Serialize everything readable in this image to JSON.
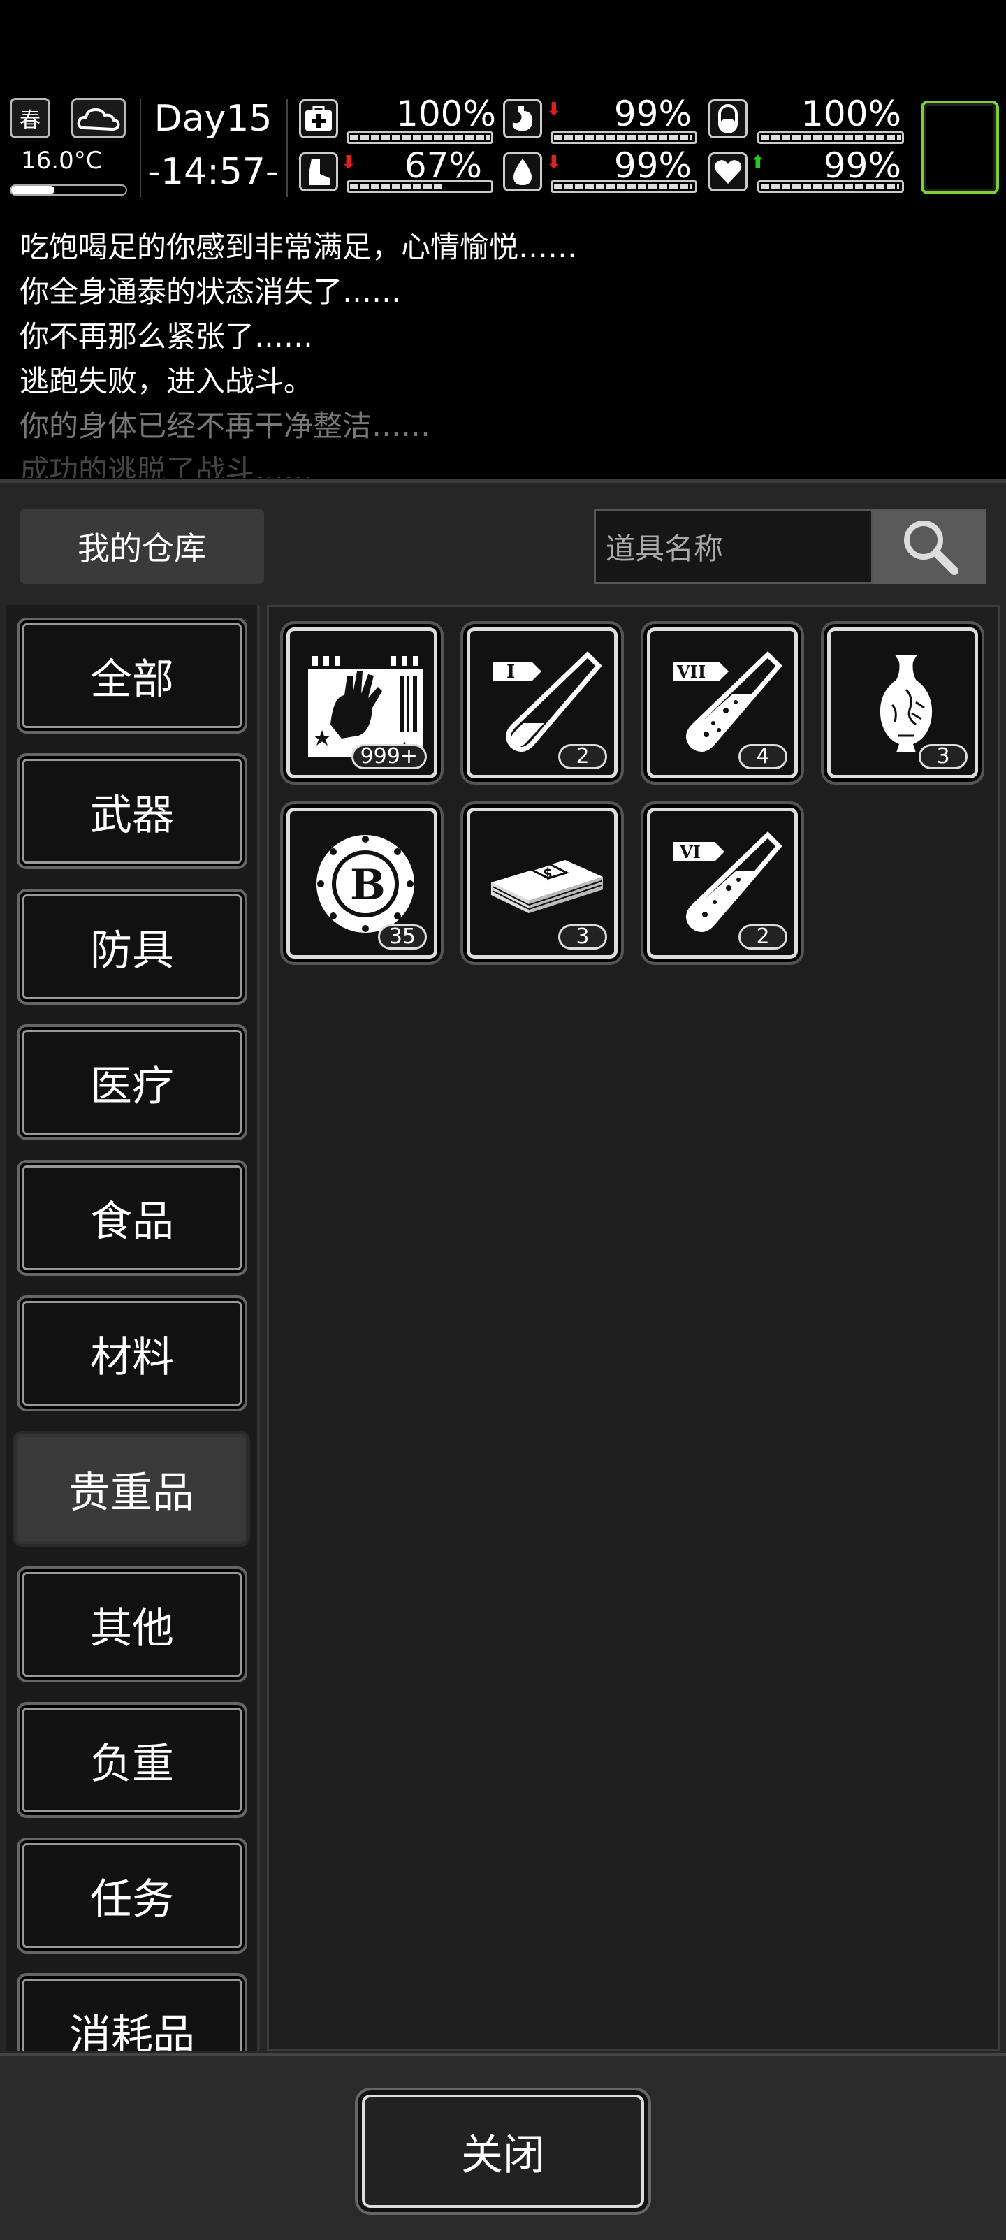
{
  "hud": {
    "season": "春",
    "temperature": "16.0°C",
    "day": "Day15",
    "time": "-14:57-",
    "stats": [
      {
        "name": "health",
        "icon": "medkit-icon",
        "value": "100%",
        "level": 1.0,
        "trend": ""
      },
      {
        "name": "hunger",
        "icon": "stomach-icon",
        "value": "99%",
        "level": 0.99,
        "trend": "down"
      },
      {
        "name": "sleep",
        "icon": "pill-icon",
        "value": "100%",
        "level": 1.0,
        "trend": ""
      },
      {
        "name": "stamina",
        "icon": "boot-icon",
        "value": "67%",
        "level": 0.67,
        "trend": "down"
      },
      {
        "name": "thirst",
        "icon": "water-drop-icon",
        "value": "99%",
        "level": 0.99,
        "trend": "down"
      },
      {
        "name": "mood",
        "icon": "heart-icon",
        "value": "99%",
        "level": 0.99,
        "trend": "up"
      }
    ],
    "colors": {
      "trend_down": "#e02020",
      "trend_up": "#28c828",
      "portrait_border": "#7ad236"
    }
  },
  "log": {
    "lines": [
      "吃饱喝足的你感到非常满足，心情愉悦……",
      "你全身通泰的状态消失了……",
      "你不再那么紧张了……",
      "逃跑失败，进入战斗。",
      "你的身体已经不再干净整洁……",
      "成功的逃脱了战斗……"
    ]
  },
  "window": {
    "title": "我的仓库",
    "search_placeholder": "道具名称",
    "categories": [
      "全部",
      "武器",
      "防具",
      "医疗",
      "食品",
      "材料",
      "贵重品",
      "其他",
      "负重",
      "任务",
      "消耗品"
    ],
    "active_category": "贵重品",
    "items": [
      {
        "icon": "zombie-hand-card-icon",
        "count": "999+"
      },
      {
        "icon": "test-tube-i-icon",
        "count": "2",
        "label": "I"
      },
      {
        "icon": "test-tube-vii-icon",
        "count": "4",
        "label": "VII"
      },
      {
        "icon": "porcelain-vase-icon",
        "count": "3"
      },
      {
        "icon": "bitcoin-coin-icon",
        "count": "35",
        "label": "B"
      },
      {
        "icon": "cash-stack-icon",
        "count": "3"
      },
      {
        "icon": "test-tube-vi-icon",
        "count": "2",
        "label": "VI"
      }
    ],
    "close_label": "关闭"
  }
}
